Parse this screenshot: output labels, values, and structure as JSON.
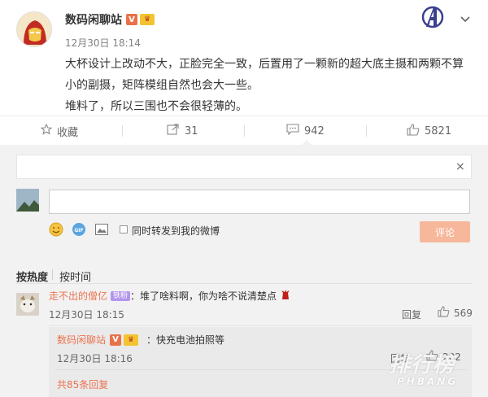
{
  "post": {
    "author": "数码闲聊站",
    "verified_badge": "V",
    "time": "12月30日 18:14",
    "text_line1": "大杯设计上改动不大，正脸完全一致，后置用了一颗新的超大底主摄和两颗不算",
    "text_line2": "小的副摄，矩阵模组自然也会大一些。",
    "text_line3": "堆料了，所以三围也不会很轻薄的。"
  },
  "actions": {
    "favorite_label": "收藏",
    "forward_count": "31",
    "comment_count": "942",
    "like_count": "5821"
  },
  "composer": {
    "forward_label": "同时转发到我的微博",
    "submit_label": "评论",
    "close_glyph": "×"
  },
  "sort": {
    "hot_label": "按热度",
    "time_label": "按时间"
  },
  "comment1": {
    "user": "走不出的僧亿",
    "tag": "铁粉",
    "text": "：堆了啥料啊，你为啥不说清楚点",
    "time": "12月30日 18:15",
    "reply_label": "回复",
    "likes": "569"
  },
  "reply1": {
    "user": "数码闲聊站",
    "verified_badge": "V",
    "text": "：快充电池拍照等",
    "time": "12月30日 18:16",
    "reply_label": "回复",
    "likes": "202"
  },
  "more_replies": "共85条回复",
  "watermark": {
    "main": "排行榜",
    "sub": "PHBANG"
  },
  "colors": {
    "link_orange": "#eb7350",
    "submit_disabled": "#f7b79b",
    "comment_bg": "#f2f2f2"
  }
}
